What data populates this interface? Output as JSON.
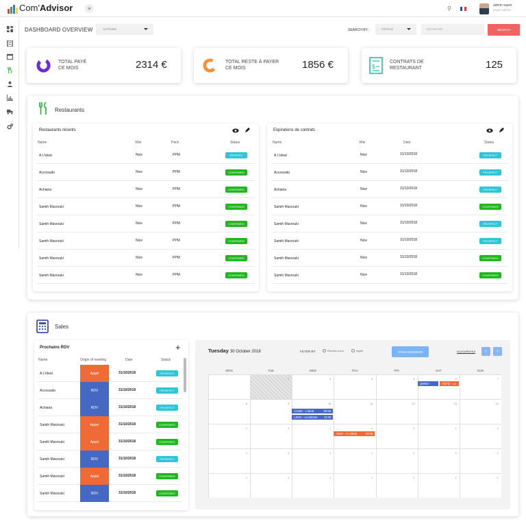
{
  "app": {
    "logo_prefix": "Com'",
    "logo_name": "Advisor",
    "logo_colors": [
      "#e53935",
      "#43a047",
      "#1e88e5",
      "#fdd835"
    ],
    "user_name": "admin super",
    "user_role": "Super admin"
  },
  "header": {
    "title": "DASHBOARD OVERVIEW",
    "actions_label": "ACTIONS",
    "search_by": "SEARCH BY:",
    "status_label": "STATUS",
    "keyword_placeholder": "KEYWORD",
    "search_button": "SEARCH"
  },
  "stats": [
    {
      "label_line1": "TOTAL PAYÉ",
      "label_line2": "CE MOIS",
      "value": "2314 €",
      "icon": "donut-purple-icon",
      "color": "#6c2bd9"
    },
    {
      "label_line1": "TOTAL RESTE À PAYER",
      "label_line2": "CE MOIS",
      "value": "1856 €",
      "icon": "donut-orange-icon",
      "color": "#f4913b"
    },
    {
      "label_line1": "CONTRATS DE",
      "label_line2": "RESTAURANT",
      "value": "125",
      "icon": "contract-icon",
      "color": "#1fbfa5"
    }
  ],
  "restaurants": {
    "title": "Restaurants",
    "recent": {
      "title": "Restaurants récents",
      "columns": [
        "Name",
        "Ville",
        "Pack",
        "Status"
      ],
      "rows": [
        {
          "name": "A L'ideal",
          "ville": "Nice",
          "pack": "PPM",
          "status": "PROSPEC",
          "kind": "prospect"
        },
        {
          "name": "Accossato",
          "ville": "Nice",
          "pack": "PPM",
          "status": "CONFIRMED",
          "kind": "confirmed"
        },
        {
          "name": "Achiana",
          "ville": "Nice",
          "pack": "PPM",
          "status": "CONFIRMED",
          "kind": "confirmed"
        },
        {
          "name": "Samih Marzouki",
          "ville": "Nice",
          "pack": "PPM",
          "status": "CONFIRMED",
          "kind": "confirmed"
        },
        {
          "name": "Samih Marzouki",
          "ville": "Nice",
          "pack": "PPM",
          "status": "CONFIRMED",
          "kind": "confirmed"
        },
        {
          "name": "Samih Marzouki",
          "ville": "Nice",
          "pack": "PPM",
          "status": "CONFIRMED",
          "kind": "confirmed"
        },
        {
          "name": "Samih Marzouki",
          "ville": "Nice",
          "pack": "PPM",
          "status": "CONFIRMED",
          "kind": "confirmed"
        },
        {
          "name": "Samih Marzouki",
          "ville": "Nice",
          "pack": "PPM",
          "status": "CONFIRMED",
          "kind": "confirmed"
        }
      ]
    },
    "expirations": {
      "title": "Expirations de contrats",
      "columns": [
        "Name",
        "Ville",
        "Date",
        "Status"
      ],
      "rows": [
        {
          "name": "A L'ideal",
          "ville": "Nice",
          "date": "31/10/2018",
          "status": "PROSPECT",
          "kind": "prospect"
        },
        {
          "name": "Accossato",
          "ville": "Nice",
          "date": "31/10/2018",
          "status": "PROSPECT",
          "kind": "prospect"
        },
        {
          "name": "Achiana",
          "ville": "Nice",
          "date": "31/10/2018",
          "status": "PROSPECT",
          "kind": "prospect"
        },
        {
          "name": "Samih Marzouki",
          "ville": "Nice",
          "date": "31/10/2018",
          "status": "CONFIRMED",
          "kind": "confirmed"
        },
        {
          "name": "Samih Marzouki",
          "ville": "Nice",
          "date": "31/10/2018",
          "status": "PROSPECT",
          "kind": "prospect"
        },
        {
          "name": "Samih Marzouki",
          "ville": "Nice",
          "date": "31/10/2018",
          "status": "PROSPECT",
          "kind": "prospect"
        },
        {
          "name": "Samih Marzouki",
          "ville": "Nice",
          "date": "31/10/2018",
          "status": "CONFIRMED",
          "kind": "confirmed"
        },
        {
          "name": "Samih Marzouki",
          "ville": "Nice",
          "date": "31/10/2018",
          "status": "CONFIRMED",
          "kind": "confirmed"
        }
      ]
    }
  },
  "sales": {
    "title": "Sales",
    "rdv": {
      "title": "Prochains RDV",
      "columns": [
        "Name",
        "Origin of meeting",
        "Date",
        "Status"
      ],
      "rows": [
        {
          "name": "A L'ideal",
          "origin": "Appel",
          "date": "31/10/2018",
          "status": "PROSPECT",
          "kind": "prospect"
        },
        {
          "name": "Accossato",
          "origin": "RDV",
          "date": "31/10/2018",
          "status": "PROSPECT",
          "kind": "prospect"
        },
        {
          "name": "Achiana",
          "origin": "RDV",
          "date": "31/10/2018",
          "status": "PROSPECT",
          "kind": "prospect"
        },
        {
          "name": "Samih Marzouki",
          "origin": "Appel",
          "date": "31/10/2018",
          "status": "CONFIRMED",
          "kind": "confirmed"
        },
        {
          "name": "Samih Marzouki",
          "origin": "Appel",
          "date": "31/10/2018",
          "status": "CONFIRMED",
          "kind": "confirmed"
        },
        {
          "name": "Samih Marzouki",
          "origin": "RDV",
          "date": "31/10/2018",
          "status": "PROSPECT",
          "kind": "prospect"
        },
        {
          "name": "Samih Marzouki",
          "origin": "Appel",
          "date": "31/10/2018",
          "status": "CONFIRMED",
          "kind": "confirmed"
        },
        {
          "name": "Samih Marzouki",
          "origin": "RDV",
          "date": "31/10/2018",
          "status": "CONFIRMED",
          "kind": "confirmed"
        }
      ]
    },
    "calendar": {
      "day_name": "Tuesday",
      "date_rest": "30 October 2018",
      "filter_label": "FILTER BY:",
      "filter_options": [
        "Rendez-vous",
        "Appel"
      ],
      "sync_button": "SYNCHRONISER",
      "today_link": "AUJOURD'HUI",
      "weekdays": [
        "MON",
        "TUE",
        "WED",
        "THU",
        "FRI",
        "SAT",
        "SUN"
      ],
      "weeks": [
        [
          "",
          "2",
          "3",
          "4",
          "5",
          "6",
          "7"
        ],
        [
          "8",
          "9",
          "10",
          "11",
          "12",
          "13",
          "14"
        ],
        [
          "1",
          "1",
          "1",
          "1",
          "1",
          "1",
          "1"
        ],
        [
          "1",
          "1",
          "1",
          "1",
          "1",
          "1",
          "1"
        ],
        [
          "1",
          "1",
          "1",
          "1",
          "1",
          "1",
          "1"
        ]
      ],
      "events": [
        {
          "label": "QWEE -",
          "time": "",
          "color": "blue"
        },
        {
          "label": "HGFD - La",
          "time": "",
          "color": "orange"
        },
        {
          "label": "COOK - L'ideal",
          "time": "09:00",
          "color": "blue"
        },
        {
          "label": "LENC - La Mérule",
          "time": "11:00",
          "color": "blue"
        },
        {
          "label": "ASSJ - A L'ideal",
          "time": "09:00",
          "color": "orange"
        }
      ]
    }
  }
}
